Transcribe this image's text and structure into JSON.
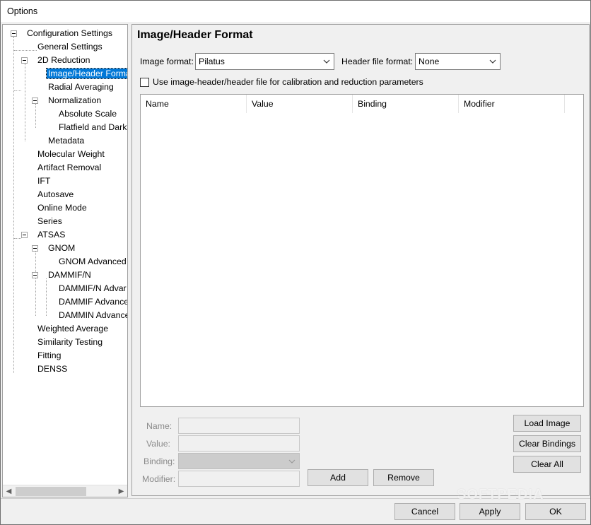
{
  "window": {
    "title": "Options"
  },
  "tree": {
    "items": [
      {
        "label": "Configuration Settings"
      },
      {
        "label": "General Settings"
      },
      {
        "label": "2D Reduction"
      },
      {
        "label": "Image/Header Forma"
      },
      {
        "label": "Radial Averaging"
      },
      {
        "label": "Normalization"
      },
      {
        "label": "Absolute Scale"
      },
      {
        "label": "Flatfield and Dark"
      },
      {
        "label": "Metadata"
      },
      {
        "label": "Molecular Weight"
      },
      {
        "label": "Artifact Removal"
      },
      {
        "label": "IFT"
      },
      {
        "label": "Autosave"
      },
      {
        "label": "Online Mode"
      },
      {
        "label": "Series"
      },
      {
        "label": "ATSAS"
      },
      {
        "label": "GNOM"
      },
      {
        "label": "GNOM Advanced"
      },
      {
        "label": "DAMMIF/N"
      },
      {
        "label": "DAMMIF/N Advar"
      },
      {
        "label": "DAMMIF Advance"
      },
      {
        "label": "DAMMIN Advance"
      },
      {
        "label": "Weighted Average"
      },
      {
        "label": "Similarity Testing"
      },
      {
        "label": "Fitting"
      },
      {
        "label": "DENSS"
      }
    ]
  },
  "panel": {
    "title": "Image/Header Format",
    "image_format_label": "Image format:",
    "image_format_value": "Pilatus",
    "header_format_label": "Header file format:",
    "header_format_value": "None",
    "use_header_checkbox_label": "Use image-header/header file for calibration and reduction parameters",
    "use_header_checked": false,
    "table_columns": [
      "Name",
      "Value",
      "Binding",
      "Modifier"
    ],
    "name_label": "Name:",
    "value_label": "Value:",
    "binding_label": "Binding:",
    "modifier_label": "Modifier:",
    "add_button": "Add",
    "remove_button": "Remove",
    "load_image_button": "Load Image",
    "clear_bindings_button": "Clear Bindings",
    "clear_all_button": "Clear All"
  },
  "footer": {
    "cancel_button": "Cancel",
    "apply_button": "Apply",
    "ok_button": "OK"
  },
  "watermark": "SOFTPEDIA"
}
